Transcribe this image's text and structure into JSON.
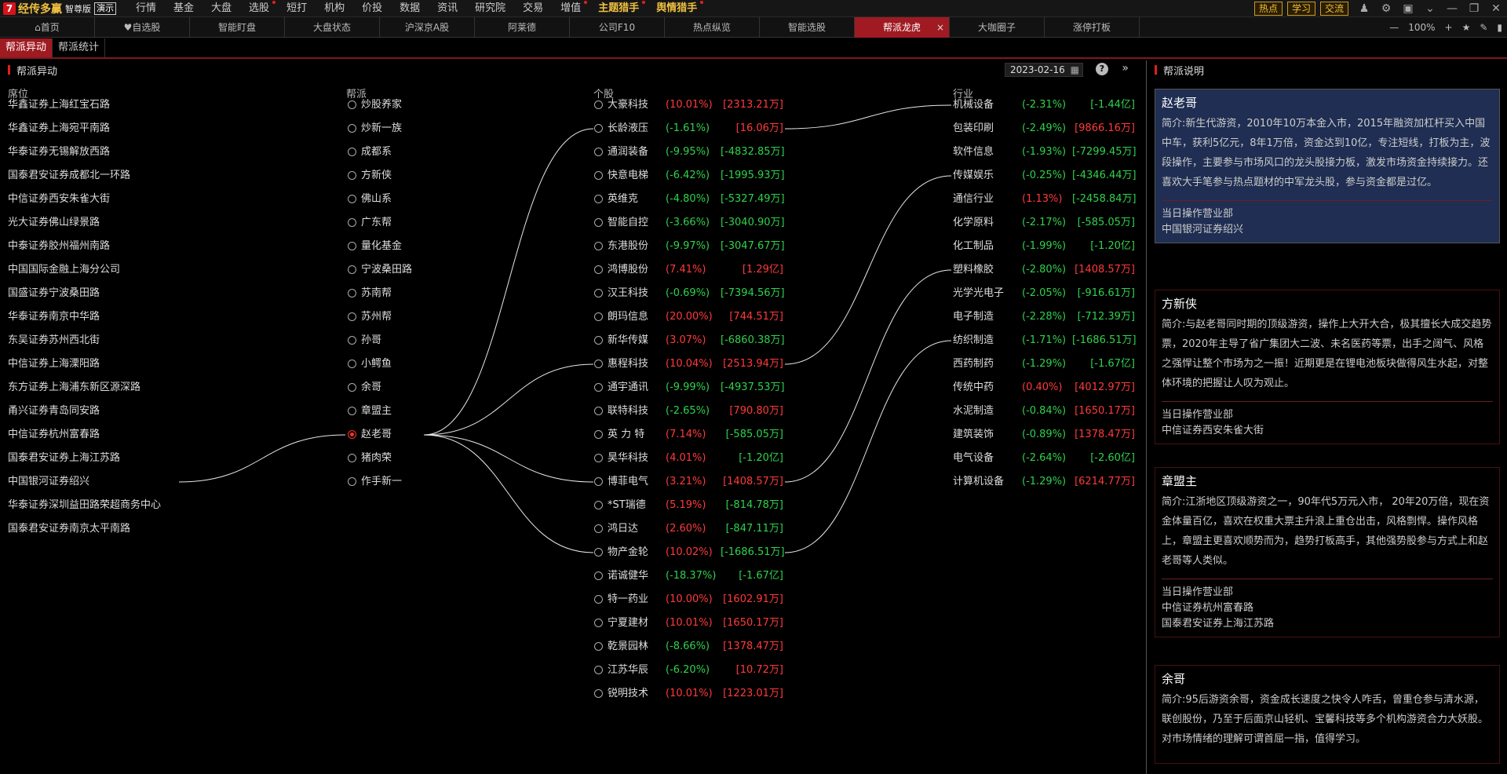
{
  "app": {
    "brand": "经传多赢",
    "edition": "智尊版",
    "demo": "演示",
    "menu": [
      {
        "label": "行情",
        "dot": false
      },
      {
        "label": "基金",
        "dot": false
      },
      {
        "label": "大盘",
        "dot": false
      },
      {
        "label": "选股",
        "dot": true
      },
      {
        "label": "短打",
        "dot": false
      },
      {
        "label": "机构",
        "dot": false
      },
      {
        "label": "价投",
        "dot": false
      },
      {
        "label": "数据",
        "dot": false
      },
      {
        "label": "资讯",
        "dot": false
      },
      {
        "label": "研究院",
        "dot": false
      },
      {
        "label": "交易",
        "dot": false
      },
      {
        "label": "增值",
        "dot": true
      },
      {
        "label": "主题猎手",
        "dot": true,
        "highlight": true
      },
      {
        "label": "舆情猎手",
        "dot": true,
        "highlight": true
      }
    ],
    "top_buttons": [
      "热点",
      "学习",
      "交流"
    ]
  },
  "tabs": [
    {
      "label": "首页",
      "icon": "home-icon"
    },
    {
      "label": "自选股",
      "icon": "heart-icon"
    },
    {
      "label": "智能盯盘"
    },
    {
      "label": "大盘状态"
    },
    {
      "label": "沪深京A股"
    },
    {
      "label": "阿莱德"
    },
    {
      "label": "公司F10"
    },
    {
      "label": "热点纵览"
    },
    {
      "label": "智能选股"
    },
    {
      "label": "帮派龙虎",
      "active": true,
      "close": "×"
    },
    {
      "label": "大咖圈子"
    },
    {
      "label": "涨停打板"
    }
  ],
  "zoom": {
    "minus": "—",
    "value": "100%",
    "plus": "+"
  },
  "subtabs": [
    {
      "label": "帮派异动",
      "active": true
    },
    {
      "label": "帮派统计"
    }
  ],
  "panel": {
    "title": "帮派异动",
    "date": "2023-02-16",
    "help": "?",
    "columns": {
      "seat": "席位",
      "gang": "帮派",
      "stock": "个股",
      "industry": "行业"
    }
  },
  "seats": [
    "华鑫证券上海红宝石路",
    "华鑫证券上海宛平南路",
    "华泰证券无锡解放西路",
    "国泰君安证券成都北一环路",
    "中信证券西安朱雀大街",
    "光大证券佛山绿景路",
    "中泰证券胶州福州南路",
    "中国国际金融上海分公司",
    "国盛证券宁波桑田路",
    "华泰证券南京中华路",
    "东吴证券苏州西北街",
    "中信证券上海溧阳路",
    "东方证券上海浦东新区源深路",
    "甬兴证券青岛同安路",
    "中信证券杭州富春路",
    "国泰君安证券上海江苏路",
    "中国银河证券绍兴",
    "华泰证券深圳益田路荣超商务中心",
    "国泰君安证券南京太平南路"
  ],
  "gangs": [
    {
      "name": "炒股养家"
    },
    {
      "name": "炒新一族"
    },
    {
      "name": "成都系"
    },
    {
      "name": "方新侠"
    },
    {
      "name": "佛山系"
    },
    {
      "name": "广东帮"
    },
    {
      "name": "量化基金"
    },
    {
      "name": "宁波桑田路"
    },
    {
      "name": "苏南帮"
    },
    {
      "name": "苏州帮"
    },
    {
      "name": "孙哥"
    },
    {
      "name": "小鳄鱼"
    },
    {
      "name": "余哥"
    },
    {
      "name": "章盟主"
    },
    {
      "name": "赵老哥",
      "selected": true
    },
    {
      "name": "猪肉荣"
    },
    {
      "name": "作手新一"
    }
  ],
  "stocks": [
    {
      "name": "大豪科技",
      "pct": "(10.01%)",
      "amt": "[2313.21万]",
      "dir": "up"
    },
    {
      "name": "长龄液压",
      "pct": "(-1.61%)",
      "amt": "[16.06万]",
      "dir": "dn",
      "amtdir": "up"
    },
    {
      "name": "通润装备",
      "pct": "(-9.95%)",
      "amt": "[-4832.85万]",
      "dir": "dn"
    },
    {
      "name": "快意电梯",
      "pct": "(-6.42%)",
      "amt": "[-1995.93万]",
      "dir": "dn"
    },
    {
      "name": "英维克",
      "pct": "(-4.80%)",
      "amt": "[-5327.49万]",
      "dir": "dn"
    },
    {
      "name": "智能自控",
      "pct": "(-3.66%)",
      "amt": "[-3040.90万]",
      "dir": "dn"
    },
    {
      "name": "东港股份",
      "pct": "(-9.97%)",
      "amt": "[-3047.67万]",
      "dir": "dn"
    },
    {
      "name": "鸿博股份",
      "pct": "(7.41%)",
      "amt": "[1.29亿]",
      "dir": "up"
    },
    {
      "name": "汉王科技",
      "pct": "(-0.69%)",
      "amt": "[-7394.56万]",
      "dir": "dn"
    },
    {
      "name": "朗玛信息",
      "pct": "(20.00%)",
      "amt": "[744.51万]",
      "dir": "up"
    },
    {
      "name": "新华传媒",
      "pct": "(3.07%)",
      "amt": "[-6860.38万]",
      "dir": "up",
      "amtdir": "dn"
    },
    {
      "name": "惠程科技",
      "pct": "(10.04%)",
      "amt": "[2513.94万]",
      "dir": "up"
    },
    {
      "name": "通宇通讯",
      "pct": "(-9.99%)",
      "amt": "[-4937.53万]",
      "dir": "dn"
    },
    {
      "name": "联特科技",
      "pct": "(-2.65%)",
      "amt": "[790.80万]",
      "dir": "dn",
      "amtdir": "up"
    },
    {
      "name": "英 力 特",
      "pct": "(7.14%)",
      "amt": "[-585.05万]",
      "dir": "up",
      "amtdir": "dn"
    },
    {
      "name": "昊华科技",
      "pct": "(4.01%)",
      "amt": "[-1.20亿]",
      "dir": "up",
      "amtdir": "dn"
    },
    {
      "name": "博菲电气",
      "pct": "(3.21%)",
      "amt": "[1408.57万]",
      "dir": "up"
    },
    {
      "name": "*ST瑞德",
      "pct": "(5.19%)",
      "amt": "[-814.78万]",
      "dir": "up",
      "amtdir": "dn"
    },
    {
      "name": "鸿日达",
      "pct": "(2.60%)",
      "amt": "[-847.11万]",
      "dir": "up",
      "amtdir": "dn"
    },
    {
      "name": "物产金轮",
      "pct": "(10.02%)",
      "amt": "[-1686.51万]",
      "dir": "up",
      "amtdir": "dn"
    },
    {
      "name": "诺诚健华",
      "pct": "(-18.37%)",
      "amt": "[-1.67亿]",
      "dir": "dn"
    },
    {
      "name": "特一药业",
      "pct": "(10.00%)",
      "amt": "[1602.91万]",
      "dir": "up"
    },
    {
      "name": "宁夏建材",
      "pct": "(10.01%)",
      "amt": "[1650.17万]",
      "dir": "up"
    },
    {
      "name": "乾景园林",
      "pct": "(-8.66%)",
      "amt": "[1378.47万]",
      "dir": "dn",
      "amtdir": "up"
    },
    {
      "name": "江苏华辰",
      "pct": "(-6.20%)",
      "amt": "[10.72万]",
      "dir": "dn",
      "amtdir": "up"
    },
    {
      "name": "锐明技术",
      "pct": "(10.01%)",
      "amt": "[1223.01万]",
      "dir": "up"
    }
  ],
  "industries": [
    {
      "name": "机械设备",
      "pct": "(-2.31%)",
      "amt": "[-1.44亿]",
      "dir": "dn"
    },
    {
      "name": "包装印刷",
      "pct": "(-2.49%)",
      "amt": "[9866.16万]",
      "dir": "dn",
      "amtdir": "up"
    },
    {
      "name": "软件信息",
      "pct": "(-1.93%)",
      "amt": "[-7299.45万]",
      "dir": "dn"
    },
    {
      "name": "传媒娱乐",
      "pct": "(-0.25%)",
      "amt": "[-4346.44万]",
      "dir": "dn"
    },
    {
      "name": "通信行业",
      "pct": "(1.13%)",
      "amt": "[-2458.84万]",
      "dir": "up",
      "amtdir": "dn"
    },
    {
      "name": "化学原料",
      "pct": "(-2.17%)",
      "amt": "[-585.05万]",
      "dir": "dn"
    },
    {
      "name": "化工制品",
      "pct": "(-1.99%)",
      "amt": "[-1.20亿]",
      "dir": "dn"
    },
    {
      "name": "塑料橡胶",
      "pct": "(-2.80%)",
      "amt": "[1408.57万]",
      "dir": "dn",
      "amtdir": "up"
    },
    {
      "name": "光学光电子",
      "pct": "(-2.05%)",
      "amt": "[-916.61万]",
      "dir": "dn"
    },
    {
      "name": "电子制造",
      "pct": "(-2.28%)",
      "amt": "[-712.39万]",
      "dir": "dn"
    },
    {
      "name": "纺织制造",
      "pct": "(-1.71%)",
      "amt": "[-1686.51万]",
      "dir": "dn"
    },
    {
      "name": "西药制药",
      "pct": "(-1.29%)",
      "amt": "[-1.67亿]",
      "dir": "dn"
    },
    {
      "name": "传统中药",
      "pct": "(0.40%)",
      "amt": "[4012.97万]",
      "dir": "up"
    },
    {
      "name": "水泥制造",
      "pct": "(-0.84%)",
      "amt": "[1650.17万]",
      "dir": "dn",
      "amtdir": "up"
    },
    {
      "name": "建筑装饰",
      "pct": "(-0.89%)",
      "amt": "[1378.47万]",
      "dir": "dn",
      "amtdir": "up"
    },
    {
      "name": "电气设备",
      "pct": "(-2.64%)",
      "amt": "[-2.60亿]",
      "dir": "dn"
    },
    {
      "name": "计算机设备",
      "pct": "(-1.29%)",
      "amt": "[6214.77万]",
      "dir": "dn",
      "amtdir": "up"
    }
  ],
  "links": {
    "seat_to_gang": [
      [
        16,
        14
      ]
    ],
    "gang_to_stock": [
      [
        14,
        1
      ],
      [
        14,
        11
      ],
      [
        14,
        16
      ],
      [
        14,
        19
      ]
    ],
    "stock_to_industry": [
      [
        1,
        0
      ],
      [
        11,
        3
      ],
      [
        16,
        7
      ],
      [
        19,
        10
      ]
    ]
  },
  "right_panel": {
    "title": "帮派说明",
    "cards": [
      {
        "name": "赵老哥",
        "desc": "简介:新生代游资，2010年10万本金入市，2015年融资加杠杆买入中国中车，获利5亿元，8年1万倍，资金达到10亿，专注短线，打板为主，波段操作，主要参与市场风口的龙头股接力板，激发市场资金持续接力。还喜欢大手笔参与热点题材的中军龙头股，参与资金都是过亿。",
        "sub": "当日操作营业部",
        "seats": [
          "中国银河证券绍兴"
        ]
      },
      {
        "name": "方新侠",
        "desc": "简介:与赵老哥同时期的顶级游资，操作上大开大合，极其擅长大成交趋势票，2020年主导了省广集团大二波、未名医药等票，出手之阔气、风格之强悍让整个市场为之一振！近期更是在锂电池板块做得风生水起，对整体环境的把握让人叹为观止。",
        "sub": "当日操作营业部",
        "seats": [
          "中信证券西安朱雀大街"
        ]
      },
      {
        "name": "章盟主",
        "desc": "简介:江浙地区顶级游资之一，90年代5万元入市， 20年20万倍，现在资金体量百亿，喜欢在权重大票主升浪上重仓出击，风格剽悍。操作风格上，章盟主更喜欢顺势而为，趋势打板高手，其他强势股参与方式上和赵老哥等人类似。",
        "sub": "当日操作营业部",
        "seats": [
          "中信证券杭州富春路",
          "国泰君安证券上海江苏路"
        ]
      },
      {
        "name": "余哥",
        "desc": "简介:95后游资余哥，资金成长速度之快令人咋舌，曾重仓参与清水源，联创股份，乃至于后面京山轻机、宝馨科技等多个机构游资合力大妖股。对市场情绪的理解可谓首屈一指，值得学习。",
        "sub": "",
        "seats": []
      }
    ]
  },
  "colors": {
    "up": "#ff3a3a",
    "down": "#2fd24c",
    "active_tab": "#a01a22",
    "card_bg": "#1f2e52",
    "brand": "#f0c040"
  }
}
